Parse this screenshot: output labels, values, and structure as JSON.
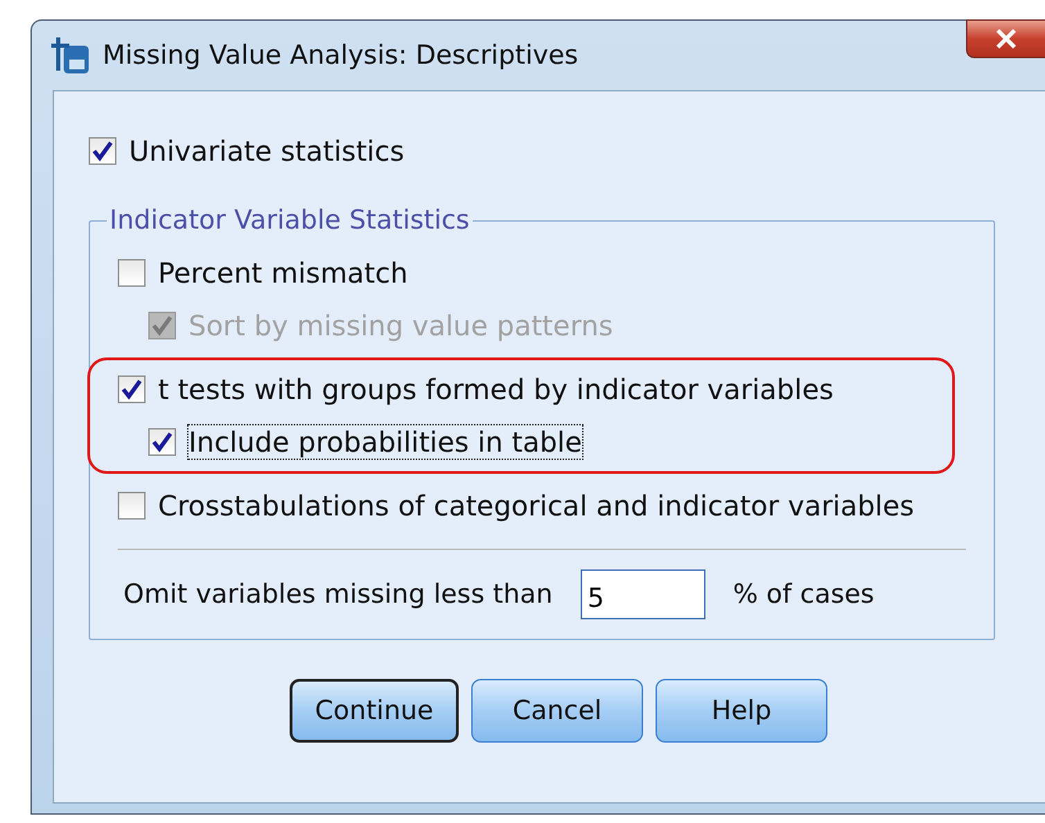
{
  "window": {
    "title": "Missing Value Analysis: Descriptives"
  },
  "univariate": {
    "label": "Univariate statistics",
    "checked": true
  },
  "group": {
    "title": "Indicator Variable Statistics",
    "options": [
      {
        "label": "Percent mismatch",
        "checked": false,
        "highlighted": false,
        "children": [
          {
            "label": "Sort by missing value patterns",
            "checked": true,
            "disabled": true,
            "focused": false
          }
        ]
      },
      {
        "label": "t tests with groups formed by indicator variables",
        "checked": true,
        "highlighted": true,
        "children": [
          {
            "label": "Include probabilities in table",
            "checked": true,
            "disabled": false,
            "focused": true
          }
        ]
      },
      {
        "label": "Crosstabulations of categorical and indicator variables",
        "checked": false,
        "highlighted": false
      }
    ],
    "omit": {
      "label": "Omit variables missing less than",
      "value": "5",
      "suffix": "% of cases"
    }
  },
  "buttons": [
    {
      "label": "Continue",
      "default": true
    },
    {
      "label": "Cancel",
      "default": false
    },
    {
      "label": "Help",
      "default": false
    }
  ]
}
